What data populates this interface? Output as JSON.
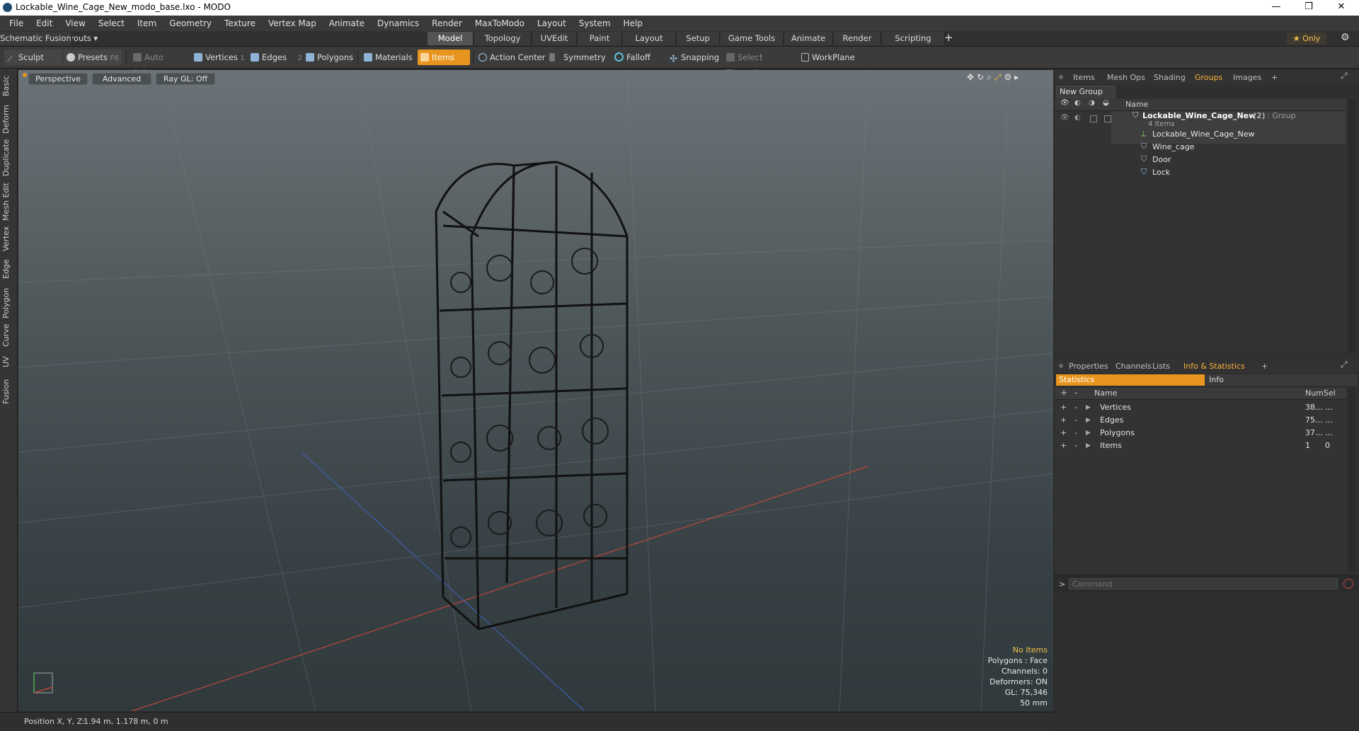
{
  "window": {
    "title": "Lockable_Wine_Cage_New_modo_base.lxo - MODO",
    "controls": [
      "—",
      "❐",
      "✕"
    ]
  },
  "menubar": [
    "File",
    "Edit",
    "View",
    "Select",
    "Item",
    "Geometry",
    "Texture",
    "Vertex Map",
    "Animate",
    "Dynamics",
    "Render",
    "MaxToModo",
    "Layout",
    "System",
    "Help"
  ],
  "layouts": {
    "preset": "Default Layouts ▾",
    "tabs": [
      "Model",
      "Topology",
      "UVEdit",
      "Paint",
      "Layout",
      "Setup",
      "Game Tools",
      "Animate",
      "Render",
      "Scripting",
      "Schematic Fusion"
    ],
    "active": "Model",
    "add": "+",
    "only": "★  Only"
  },
  "toolbar": {
    "sculpt": "Sculpt",
    "presets": "Presets",
    "presets_key": "F6",
    "auto_select": "Auto Select",
    "vertices": "Vertices",
    "vertices_n": "1",
    "edges": "Edges",
    "edges_n": "2",
    "polygons": "Polygons",
    "materials": "Materials",
    "items": "Items",
    "action_center": "Action Center",
    "symmetry": "Symmetry",
    "falloff": "Falloff",
    "snapping": "Snapping",
    "select_through": "Select Through",
    "workplane": "WorkPlane"
  },
  "left_tabs": [
    "Basic",
    "Deform",
    "Duplicate",
    "Mesh Edit",
    "Vertex",
    "Edge",
    "Polygon",
    "Curve",
    "UV",
    "Fusion"
  ],
  "viewport": {
    "view": "Perspective",
    "shading": "Advanced",
    "raygl": "Ray GL: Off",
    "hud": {
      "items": "No Items",
      "polygons": "Polygons : Face",
      "channels": "Channels: 0",
      "deformers": "Deformers: ON",
      "gl": "GL: 75,346",
      "scale": "50 mm"
    }
  },
  "status": {
    "label": "Position X, Y, Z:",
    "value": "1.94 m, 1.178 m, 0 m"
  },
  "groups_panel": {
    "tabs": [
      "Items",
      "Mesh Ops",
      "Shading",
      "Groups",
      "Images",
      "+"
    ],
    "active": "Groups",
    "new_group": "New Group",
    "col_name": "Name",
    "group": {
      "name": "Lockable_Wine_Cage_New",
      "count": "(2)",
      "type": ": Group",
      "sub": "4 Items"
    },
    "children": [
      "Lockable_Wine_Cage_New",
      "Wine_cage",
      "Door",
      "Lock"
    ]
  },
  "info_panel": {
    "tabs": [
      "Properties",
      "Channels",
      "Lists",
      "Info & Statistics",
      "+"
    ],
    "active": "Info & Statistics",
    "subtabs": [
      "Statistics",
      "Info"
    ],
    "cols": [
      "Name",
      "Num",
      "Sel"
    ],
    "rows": [
      {
        "name": "Vertices",
        "num": "38…",
        "sel": "…"
      },
      {
        "name": "Edges",
        "num": "75…",
        "sel": "…"
      },
      {
        "name": "Polygons",
        "num": "37…",
        "sel": "…"
      },
      {
        "name": "Items",
        "num": "1",
        "sel": "0"
      }
    ]
  },
  "command": {
    "prompt": ">",
    "placeholder": "Command"
  }
}
